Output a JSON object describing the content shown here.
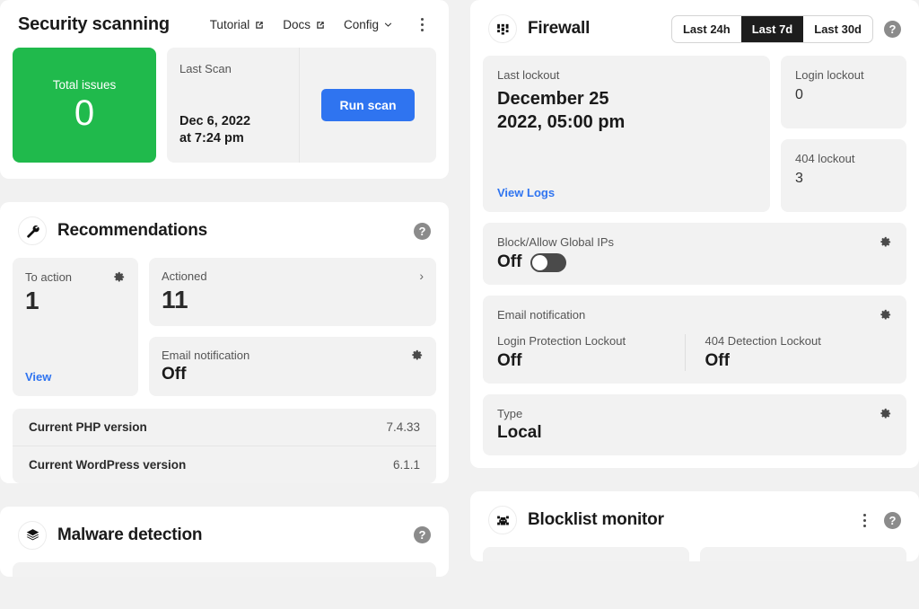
{
  "security": {
    "title": "Security scanning",
    "nav": [
      {
        "label": "Tutorial",
        "icon": "external-link-icon"
      },
      {
        "label": "Docs",
        "icon": "external-link-icon"
      },
      {
        "label": "Config",
        "icon": "chevron-down-icon"
      }
    ],
    "more_menu_icon": "kebab-menu-icon",
    "total_issues": {
      "label": "Total issues",
      "value": "0",
      "color": "#20ba4c"
    },
    "last_scan": {
      "label": "Last Scan",
      "date_line1": "Dec 6, 2022",
      "date_line2": "at 7:24 pm"
    },
    "run_scan_label": "Run scan"
  },
  "recommendations": {
    "title": "Recommendations",
    "icon": "wrench-icon",
    "help_label": "?",
    "to_action": {
      "label": "To action",
      "value": "1",
      "link": "View",
      "gear": "gear-icon"
    },
    "actioned": {
      "label": "Actioned",
      "value": "11",
      "chevron": "›"
    },
    "email_notification": {
      "label": "Email notification",
      "value": "Off",
      "gear": "gear-icon"
    },
    "versions": [
      {
        "key": "Current PHP version",
        "value": "7.4.33"
      },
      {
        "key": "Current WordPress version",
        "value": "6.1.1"
      }
    ]
  },
  "firewall": {
    "title": "Firewall",
    "icon": "firewall-icon",
    "help_label": "?",
    "ranges": [
      {
        "label": "Last 24h",
        "selected": false
      },
      {
        "label": "Last 7d",
        "selected": true
      },
      {
        "label": "Last 30d",
        "selected": false
      }
    ],
    "last_lockout": {
      "label": "Last lockout",
      "date_line1": "December 25",
      "date_line2": "2022, 05:00 pm",
      "link": "View Logs"
    },
    "login_lockout": {
      "label": "Login lockout",
      "value": "0"
    },
    "notfound_lockout": {
      "label": "404 lockout",
      "value": "3"
    },
    "block_allow": {
      "label": "Block/Allow Global IPs",
      "value": "Off",
      "gear": "gear-icon"
    },
    "email_notification": {
      "label": "Email notification",
      "gear": "gear-icon",
      "items": [
        {
          "label": "Login Protection Lockout",
          "value": "Off"
        },
        {
          "label": "404 Detection Lockout",
          "value": "Off"
        }
      ]
    },
    "type": {
      "label": "Type",
      "value": "Local",
      "gear": "gear-icon"
    }
  },
  "malware": {
    "title": "Malware detection",
    "icon": "layers-icon",
    "help_label": "?"
  },
  "blocklist": {
    "title": "Blocklist monitor",
    "icon": "bug-icon",
    "help_label": "?",
    "more_menu_icon": "kebab-menu-icon"
  },
  "colors": {
    "accent_blue": "#2f74f0",
    "success_green": "#20ba4c",
    "panel_bg": "#ffffff",
    "tile_bg": "#f2f2f2",
    "page_bg": "#f1f1f1"
  }
}
